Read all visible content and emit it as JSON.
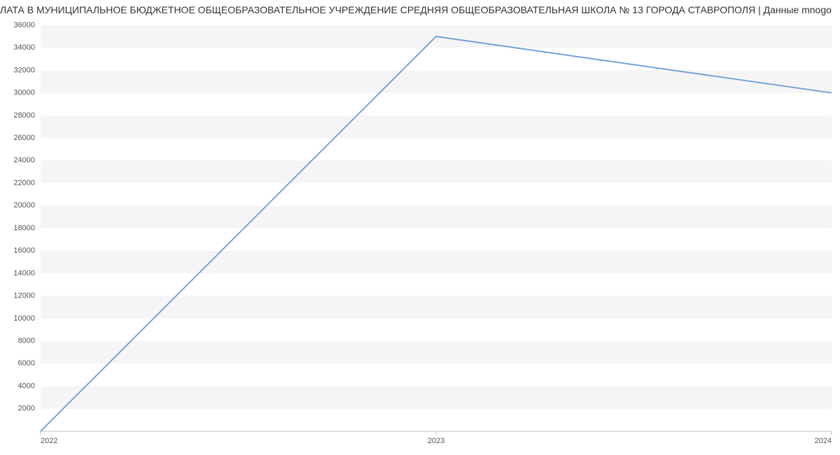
{
  "title": "ЛАТА В МУНИЦИПАЛЬНОЕ БЮДЖЕТНОЕ ОБЩЕОБРАЗОВАТЕЛЬНОЕ УЧРЕЖДЕНИЕ СРЕДНЯЯ ОБЩЕОБРАЗОВАТЕЛЬНАЯ ШКОЛА № 13 ГОРОДА СТАВРОПОЛЯ | Данные mnogo",
  "chart_data": {
    "type": "line",
    "title": "ЛАТА В МУНИЦИПАЛЬНОЕ БЮДЖЕТНОЕ ОБЩЕОБРАЗОВАТЕЛЬНОЕ УЧРЕЖДЕНИЕ СРЕДНЯЯ ОБЩЕОБРАЗОВАТЕЛЬНАЯ ШКОЛА № 13 ГОРОДА СТАВРОПОЛЯ | Данные mnogo",
    "xlabel": "",
    "ylabel": "",
    "categories": [
      "2022",
      "2023",
      "2024"
    ],
    "x": [
      2022,
      2023,
      2024
    ],
    "values": [
      0,
      35000,
      30000
    ],
    "ylim": [
      0,
      36000
    ],
    "y_ticks": [
      2000,
      4000,
      6000,
      8000,
      10000,
      12000,
      14000,
      16000,
      18000,
      20000,
      22000,
      24000,
      26000,
      28000,
      30000,
      32000,
      34000,
      36000
    ],
    "line_color": "#6e9bd5",
    "grid": true
  }
}
